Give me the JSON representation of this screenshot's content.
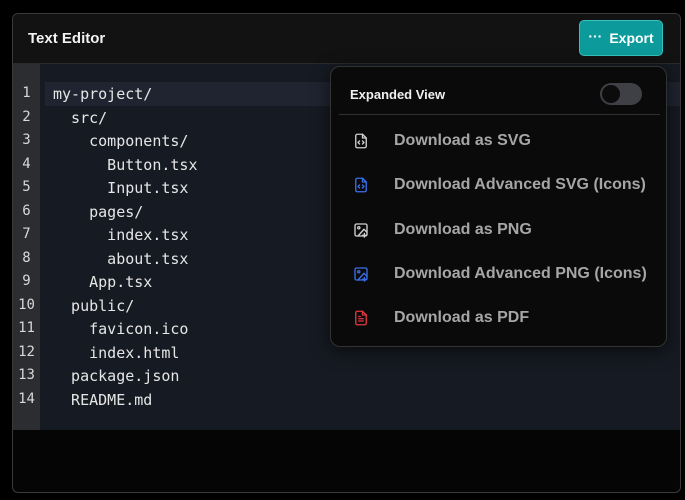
{
  "header": {
    "title": "Text Editor",
    "export_label": "Export",
    "export_icon": "···"
  },
  "editor": {
    "lines": [
      {
        "num": "1",
        "text": "my-project/"
      },
      {
        "num": "2",
        "text": "  src/"
      },
      {
        "num": "3",
        "text": "    components/"
      },
      {
        "num": "4",
        "text": "      Button.tsx"
      },
      {
        "num": "5",
        "text": "      Input.tsx"
      },
      {
        "num": "6",
        "text": "    pages/"
      },
      {
        "num": "7",
        "text": "      index.tsx"
      },
      {
        "num": "8",
        "text": "      about.tsx"
      },
      {
        "num": "9",
        "text": "    App.tsx"
      },
      {
        "num": "10",
        "text": "  public/"
      },
      {
        "num": "11",
        "text": "    favicon.ico"
      },
      {
        "num": "12",
        "text": "    index.html"
      },
      {
        "num": "13",
        "text": "  package.json"
      },
      {
        "num": "14",
        "text": "  README.md"
      }
    ]
  },
  "dropdown": {
    "expanded_view_label": "Expanded View",
    "expanded_view_on": false,
    "items": [
      {
        "label": "Download as SVG",
        "icon": "file-code-icon",
        "color": "#d0d0d0"
      },
      {
        "label": "Download Advanced SVG (Icons)",
        "icon": "file-code-icon",
        "color": "#3b6fe8"
      },
      {
        "label": "Download as PNG",
        "icon": "image-icon",
        "color": "#d0d0d0"
      },
      {
        "label": "Download Advanced PNG (Icons)",
        "icon": "image-icon",
        "color": "#3b6fe8"
      },
      {
        "label": "Download as PDF",
        "icon": "file-text-icon",
        "color": "#e0383e"
      }
    ]
  },
  "colors": {
    "accent": "#0d9a9a",
    "background": "#000000"
  }
}
